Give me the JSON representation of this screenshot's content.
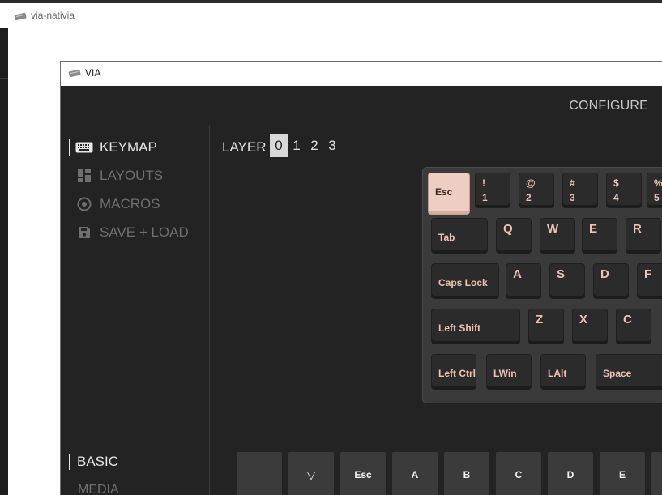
{
  "outer_window": {
    "title": "via-nativia"
  },
  "via_window": {
    "title": "VIA"
  },
  "topnav": {
    "configure": "CONFIGURE"
  },
  "sidebar": {
    "items": [
      {
        "label": "KEYMAP",
        "icon": "keyboard-icon",
        "active": true
      },
      {
        "label": "LAYOUTS",
        "icon": "layouts-icon",
        "active": false
      },
      {
        "label": "MACROS",
        "icon": "macros-icon",
        "active": false
      },
      {
        "label": "SAVE + LOAD",
        "icon": "save-icon",
        "active": false
      }
    ]
  },
  "layers": {
    "label": "LAYER",
    "options": [
      "0",
      "1",
      "2",
      "3"
    ],
    "selected": "0"
  },
  "keyboard": {
    "row1": [
      {
        "main": "Esc"
      },
      {
        "top": "!",
        "bottom": "1"
      },
      {
        "top": "@",
        "bottom": "2"
      },
      {
        "top": "#",
        "bottom": "3"
      },
      {
        "top": "$",
        "bottom": "4"
      },
      {
        "top": "%",
        "bottom": "5"
      }
    ],
    "row2": [
      "Tab",
      "Q",
      "W",
      "E",
      "R"
    ],
    "row3": [
      "Caps Lock",
      "A",
      "S",
      "D",
      "F"
    ],
    "row4": [
      "Left Shift",
      "Z",
      "X",
      "C"
    ],
    "row5": [
      "Left Ctrl",
      "LWin",
      "LAlt",
      "Space"
    ]
  },
  "bottom": {
    "categories": [
      "BASIC",
      "MEDIA"
    ],
    "palette_keys": [
      "",
      "▽",
      "Esc",
      "A",
      "B",
      "C",
      "D",
      "E"
    ]
  },
  "colors": {
    "accent_key": "#eecdc2",
    "legend_text": "#f1c2b2",
    "background": "#232323"
  }
}
